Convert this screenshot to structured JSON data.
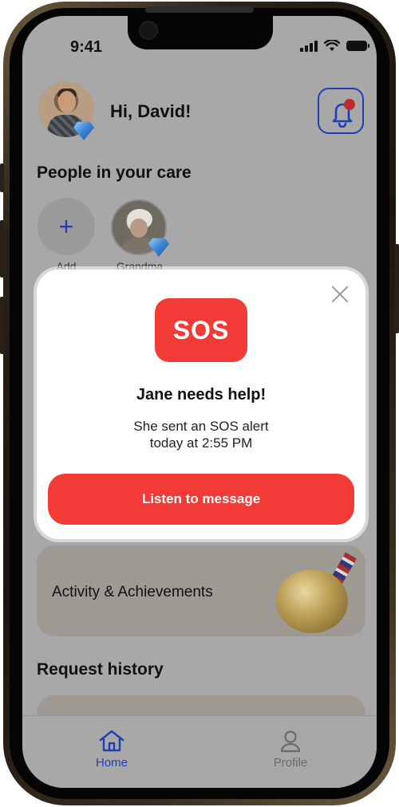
{
  "status_bar": {
    "time": "9:41"
  },
  "header": {
    "greeting": "Hi, David!"
  },
  "care": {
    "title": "People in your care",
    "add_label": "Add",
    "people": [
      {
        "label": "Grandma"
      }
    ]
  },
  "modal": {
    "badge": "SOS",
    "title": "Jane needs help!",
    "description_line1": "She sent an SOS alert",
    "description_line2": "today at 2:55 PM",
    "button": "Listen to message"
  },
  "activity": {
    "label": "Activity & Achievements"
  },
  "request_history": {
    "title": "Request history"
  },
  "tabbar": {
    "tabs": [
      {
        "label": "Home",
        "active": true
      },
      {
        "label": "Profile",
        "active": false
      }
    ]
  },
  "colors": {
    "accent": "#1f3fb5",
    "sos_red": "#f23a37",
    "overlay": "#a8a8a8"
  },
  "icons": [
    "plus-icon",
    "bell-icon",
    "close-icon",
    "home-icon",
    "profile-icon",
    "diamond-badge-icon",
    "medal-icon"
  ]
}
